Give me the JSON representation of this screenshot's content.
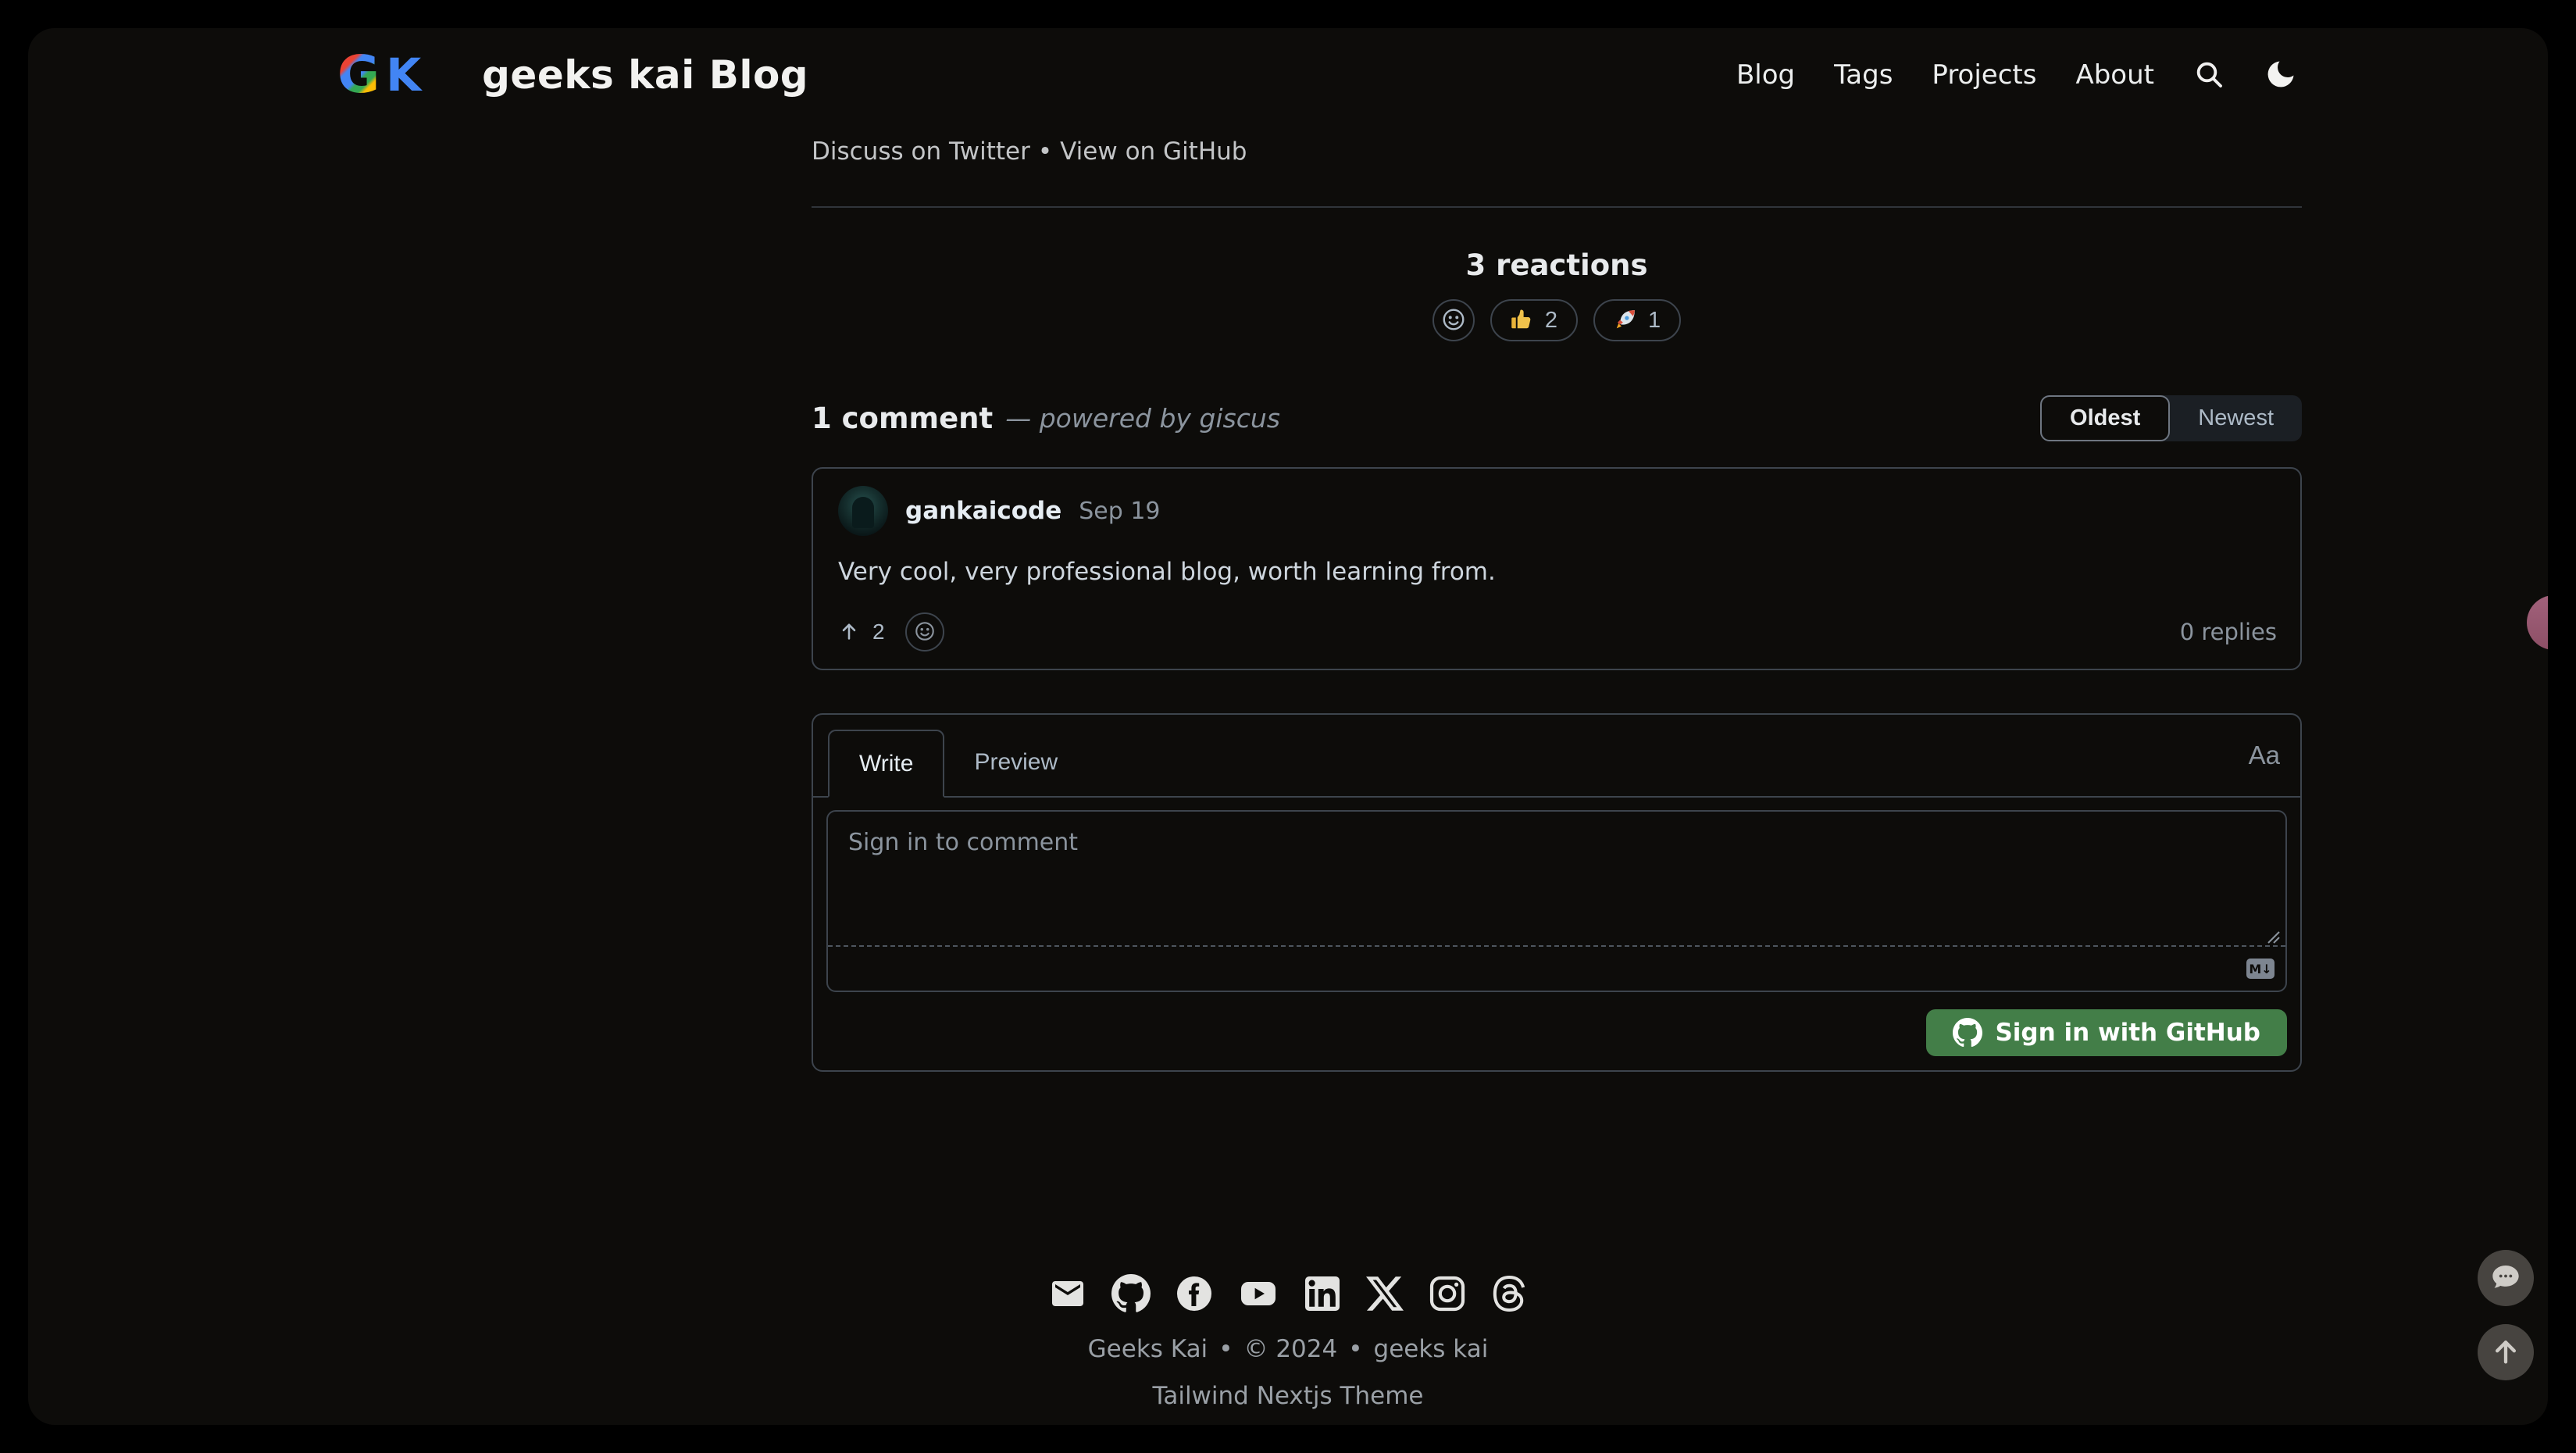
{
  "header": {
    "logo": {
      "g": "G",
      "k": "K"
    },
    "title": "geeks kai Blog",
    "nav": [
      {
        "label": "Blog"
      },
      {
        "label": "Tags"
      },
      {
        "label": "Projects"
      },
      {
        "label": "About"
      }
    ]
  },
  "post_links": {
    "discuss": "Discuss on Twitter",
    "separator": "•",
    "view": "View on GitHub"
  },
  "reactions": {
    "heading": "3 reactions",
    "items": [
      {
        "icon": "thumbs-up-emoji",
        "count": "2"
      },
      {
        "icon": "rocket-emoji",
        "count": "1"
      }
    ]
  },
  "comments": {
    "count_label": "1 comment",
    "powered_by": "— powered by giscus",
    "sort_oldest": "Oldest",
    "sort_newest": "Newest",
    "comment": {
      "author": "gankaicode",
      "date": "Sep 19",
      "body": "Very cool, very professional blog, worth learning from.",
      "upvotes": "2",
      "replies": "0 replies"
    }
  },
  "composer": {
    "tab_write": "Write",
    "tab_preview": "Preview",
    "text_style_label": "Aa",
    "placeholder": "Sign in to comment",
    "signin_label": "Sign in with GitHub"
  },
  "footer": {
    "icons": [
      "mail",
      "github",
      "facebook",
      "youtube",
      "linkedin",
      "x",
      "instagram",
      "threads"
    ],
    "site_name": "Geeks Kai",
    "dot1": "•",
    "copyright": "© 2024",
    "dot2": "•",
    "author": "geeks kai",
    "theme_credit": "Tailwind Nextjs Theme"
  },
  "colors": {
    "background": "#000000",
    "surface": "#0d0c0a",
    "border": "#3d444d",
    "text_primary": "#e6edf3",
    "text_secondary": "#8b949e",
    "accent_green": "#437e48",
    "logo_blue": "#4285f4",
    "pink_widget": "#9a5b73"
  }
}
